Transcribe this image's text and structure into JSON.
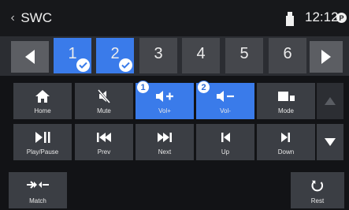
{
  "header": {
    "title": "SWC",
    "clock": "12:12",
    "status_badge": "P"
  },
  "pages": [
    {
      "label": "1",
      "active": true,
      "checked": true
    },
    {
      "label": "2",
      "active": true,
      "checked": true
    },
    {
      "label": "3",
      "active": false,
      "checked": false
    },
    {
      "label": "4",
      "active": false,
      "checked": false
    },
    {
      "label": "5",
      "active": false,
      "checked": false
    },
    {
      "label": "6",
      "active": false,
      "checked": false
    }
  ],
  "functions": {
    "home": {
      "label": "Home"
    },
    "mute": {
      "label": "Mute"
    },
    "vol_up": {
      "label": "Vol+",
      "assigned_index": "1"
    },
    "vol_down": {
      "label": "Vol-",
      "assigned_index": "2"
    },
    "mode": {
      "label": "Mode"
    },
    "play_pause": {
      "label": "Play/Pause"
    },
    "prev": {
      "label": "Prev"
    },
    "next": {
      "label": "Next"
    },
    "up": {
      "label": "Up"
    },
    "down": {
      "label": "Down"
    }
  },
  "bottom": {
    "match": {
      "label": "Match"
    },
    "reset": {
      "label": "Rest"
    }
  },
  "colors": {
    "accent": "#3a7bea",
    "tile": "#3b3e44",
    "background": "#121316"
  }
}
